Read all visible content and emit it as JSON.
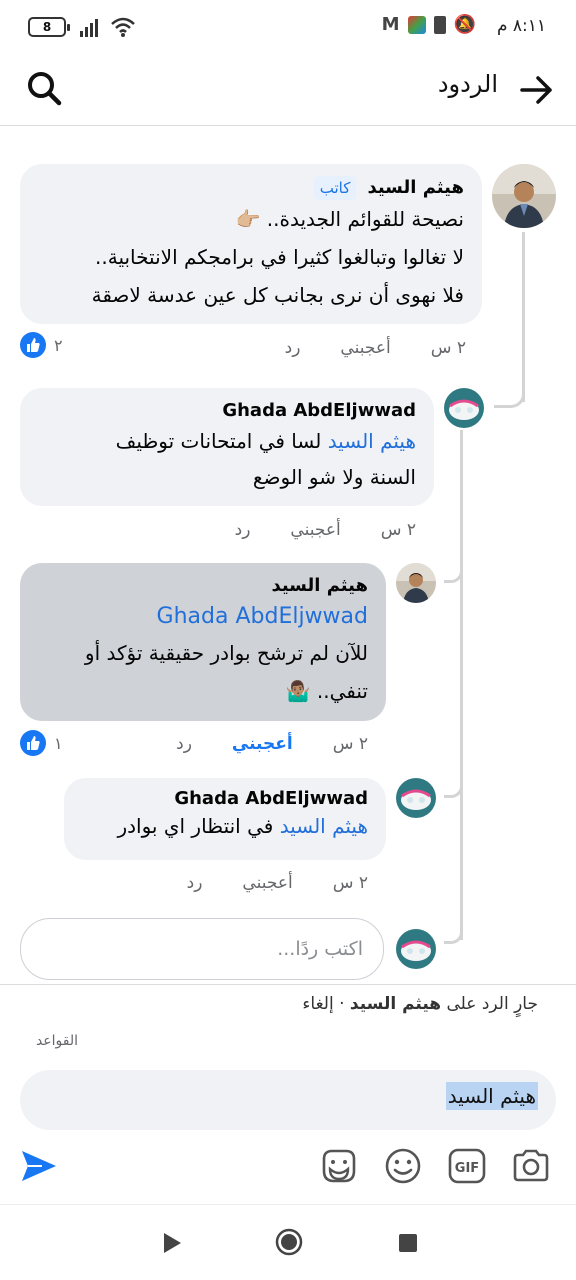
{
  "status_bar": {
    "time": "٨:١١ م",
    "battery": "8"
  },
  "header": {
    "title": "الردود"
  },
  "comments": [
    {
      "author": "هيثم السيد",
      "badge": "كاتب",
      "line1": "نصيحة للقوائم الجديدة..",
      "line2": "لا تغالوا وتبالغوا كثيرا في برامجكم الانتخابية..",
      "line3": "فلا نهوى أن نرى بجانب كل عين عدسة لاصقة",
      "time": "٢ س",
      "like_label": "أعجبني",
      "reply_label": "رد",
      "reactions": "٢"
    },
    {
      "author": "Ghada AbdEljwwad",
      "mention": "هيثم السيد",
      "line1": "لسا في امتحانات توظيف",
      "line2": "السنة ولا شو الوضع",
      "time": "٢ س",
      "like_label": "أعجبني",
      "reply_label": "رد"
    },
    {
      "author": "هيثم السيد",
      "mention": "Ghada AbdEljwwad",
      "line1": "للآن لم ترشح بوادر حقيقية تؤكد أو",
      "line2": "تنفي..",
      "time": "٢ س",
      "like_label": "أعجبني",
      "reply_label": "رد",
      "reactions": "١"
    },
    {
      "author": "Ghada AbdEljwwad",
      "mention": "هيثم السيد",
      "line1": "في انتظار اي بوادر",
      "time": "٢ س",
      "like_label": "أعجبني",
      "reply_label": "رد"
    }
  ],
  "reply_input": {
    "placeholder": "اكتب ردًا..."
  },
  "composer": {
    "replying_prefix": "جارٍ الرد على",
    "replying_name": "هيثم السيد",
    "cancel": "إلغاء",
    "rules": "القواعد",
    "text": "هيثم السيد"
  },
  "colors": {
    "accent": "#1877f2",
    "mention": "#216fdb",
    "bubble": "#f0f2f5",
    "bubble_selected": "#cfd2d6"
  }
}
